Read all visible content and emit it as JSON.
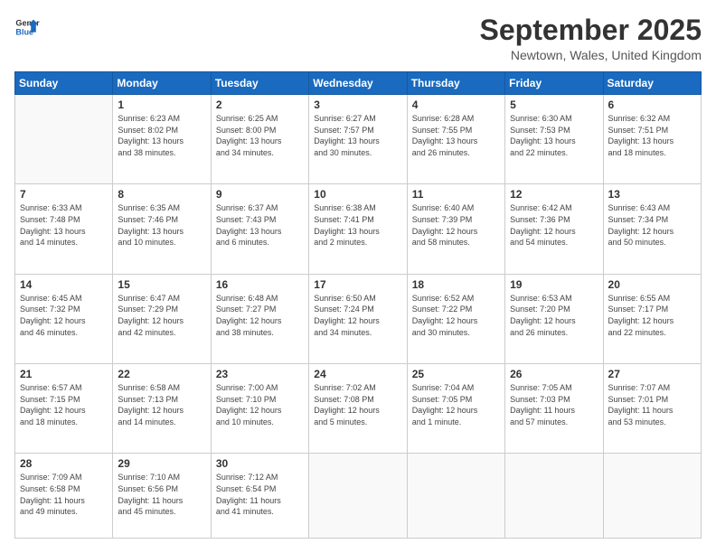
{
  "header": {
    "logo_line1": "General",
    "logo_line2": "Blue",
    "month": "September 2025",
    "location": "Newtown, Wales, United Kingdom"
  },
  "weekdays": [
    "Sunday",
    "Monday",
    "Tuesday",
    "Wednesday",
    "Thursday",
    "Friday",
    "Saturday"
  ],
  "weeks": [
    [
      {
        "day": "",
        "info": ""
      },
      {
        "day": "1",
        "info": "Sunrise: 6:23 AM\nSunset: 8:02 PM\nDaylight: 13 hours\nand 38 minutes."
      },
      {
        "day": "2",
        "info": "Sunrise: 6:25 AM\nSunset: 8:00 PM\nDaylight: 13 hours\nand 34 minutes."
      },
      {
        "day": "3",
        "info": "Sunrise: 6:27 AM\nSunset: 7:57 PM\nDaylight: 13 hours\nand 30 minutes."
      },
      {
        "day": "4",
        "info": "Sunrise: 6:28 AM\nSunset: 7:55 PM\nDaylight: 13 hours\nand 26 minutes."
      },
      {
        "day": "5",
        "info": "Sunrise: 6:30 AM\nSunset: 7:53 PM\nDaylight: 13 hours\nand 22 minutes."
      },
      {
        "day": "6",
        "info": "Sunrise: 6:32 AM\nSunset: 7:51 PM\nDaylight: 13 hours\nand 18 minutes."
      }
    ],
    [
      {
        "day": "7",
        "info": "Sunrise: 6:33 AM\nSunset: 7:48 PM\nDaylight: 13 hours\nand 14 minutes."
      },
      {
        "day": "8",
        "info": "Sunrise: 6:35 AM\nSunset: 7:46 PM\nDaylight: 13 hours\nand 10 minutes."
      },
      {
        "day": "9",
        "info": "Sunrise: 6:37 AM\nSunset: 7:43 PM\nDaylight: 13 hours\nand 6 minutes."
      },
      {
        "day": "10",
        "info": "Sunrise: 6:38 AM\nSunset: 7:41 PM\nDaylight: 13 hours\nand 2 minutes."
      },
      {
        "day": "11",
        "info": "Sunrise: 6:40 AM\nSunset: 7:39 PM\nDaylight: 12 hours\nand 58 minutes."
      },
      {
        "day": "12",
        "info": "Sunrise: 6:42 AM\nSunset: 7:36 PM\nDaylight: 12 hours\nand 54 minutes."
      },
      {
        "day": "13",
        "info": "Sunrise: 6:43 AM\nSunset: 7:34 PM\nDaylight: 12 hours\nand 50 minutes."
      }
    ],
    [
      {
        "day": "14",
        "info": "Sunrise: 6:45 AM\nSunset: 7:32 PM\nDaylight: 12 hours\nand 46 minutes."
      },
      {
        "day": "15",
        "info": "Sunrise: 6:47 AM\nSunset: 7:29 PM\nDaylight: 12 hours\nand 42 minutes."
      },
      {
        "day": "16",
        "info": "Sunrise: 6:48 AM\nSunset: 7:27 PM\nDaylight: 12 hours\nand 38 minutes."
      },
      {
        "day": "17",
        "info": "Sunrise: 6:50 AM\nSunset: 7:24 PM\nDaylight: 12 hours\nand 34 minutes."
      },
      {
        "day": "18",
        "info": "Sunrise: 6:52 AM\nSunset: 7:22 PM\nDaylight: 12 hours\nand 30 minutes."
      },
      {
        "day": "19",
        "info": "Sunrise: 6:53 AM\nSunset: 7:20 PM\nDaylight: 12 hours\nand 26 minutes."
      },
      {
        "day": "20",
        "info": "Sunrise: 6:55 AM\nSunset: 7:17 PM\nDaylight: 12 hours\nand 22 minutes."
      }
    ],
    [
      {
        "day": "21",
        "info": "Sunrise: 6:57 AM\nSunset: 7:15 PM\nDaylight: 12 hours\nand 18 minutes."
      },
      {
        "day": "22",
        "info": "Sunrise: 6:58 AM\nSunset: 7:13 PM\nDaylight: 12 hours\nand 14 minutes."
      },
      {
        "day": "23",
        "info": "Sunrise: 7:00 AM\nSunset: 7:10 PM\nDaylight: 12 hours\nand 10 minutes."
      },
      {
        "day": "24",
        "info": "Sunrise: 7:02 AM\nSunset: 7:08 PM\nDaylight: 12 hours\nand 5 minutes."
      },
      {
        "day": "25",
        "info": "Sunrise: 7:04 AM\nSunset: 7:05 PM\nDaylight: 12 hours\nand 1 minute."
      },
      {
        "day": "26",
        "info": "Sunrise: 7:05 AM\nSunset: 7:03 PM\nDaylight: 11 hours\nand 57 minutes."
      },
      {
        "day": "27",
        "info": "Sunrise: 7:07 AM\nSunset: 7:01 PM\nDaylight: 11 hours\nand 53 minutes."
      }
    ],
    [
      {
        "day": "28",
        "info": "Sunrise: 7:09 AM\nSunset: 6:58 PM\nDaylight: 11 hours\nand 49 minutes."
      },
      {
        "day": "29",
        "info": "Sunrise: 7:10 AM\nSunset: 6:56 PM\nDaylight: 11 hours\nand 45 minutes."
      },
      {
        "day": "30",
        "info": "Sunrise: 7:12 AM\nSunset: 6:54 PM\nDaylight: 11 hours\nand 41 minutes."
      },
      {
        "day": "",
        "info": ""
      },
      {
        "day": "",
        "info": ""
      },
      {
        "day": "",
        "info": ""
      },
      {
        "day": "",
        "info": ""
      }
    ]
  ]
}
